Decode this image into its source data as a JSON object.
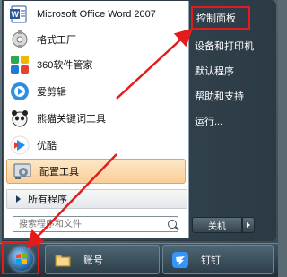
{
  "start_menu": {
    "programs": [
      {
        "label": "Microsoft Office Word 2007",
        "icon": "word-icon"
      },
      {
        "label": "格式工厂",
        "icon": "format-factory-icon"
      },
      {
        "label": "360软件管家",
        "icon": "360-software-icon"
      },
      {
        "label": "爱剪辑",
        "icon": "aijianji-icon"
      },
      {
        "label": "熊猫关键词工具",
        "icon": "panda-tool-icon"
      },
      {
        "label": "优酷",
        "icon": "youku-icon"
      },
      {
        "label": "配置工具",
        "icon": "config-tool-icon"
      }
    ],
    "all_programs_label": "所有程序",
    "search_placeholder": "搜索程序和文件",
    "right_pane": [
      "控制面板",
      "设备和打印机",
      "默认程序",
      "帮助和支持",
      "运行..."
    ],
    "shutdown_label": "关机"
  },
  "taskbar": {
    "items": [
      {
        "label": "账号",
        "icon": "folder-icon"
      },
      {
        "label": "钉钉",
        "icon": "dingtalk-icon"
      }
    ]
  },
  "colors": {
    "highlight_red": "#e21b1b",
    "selected_item_bg": "#f9cf99"
  }
}
